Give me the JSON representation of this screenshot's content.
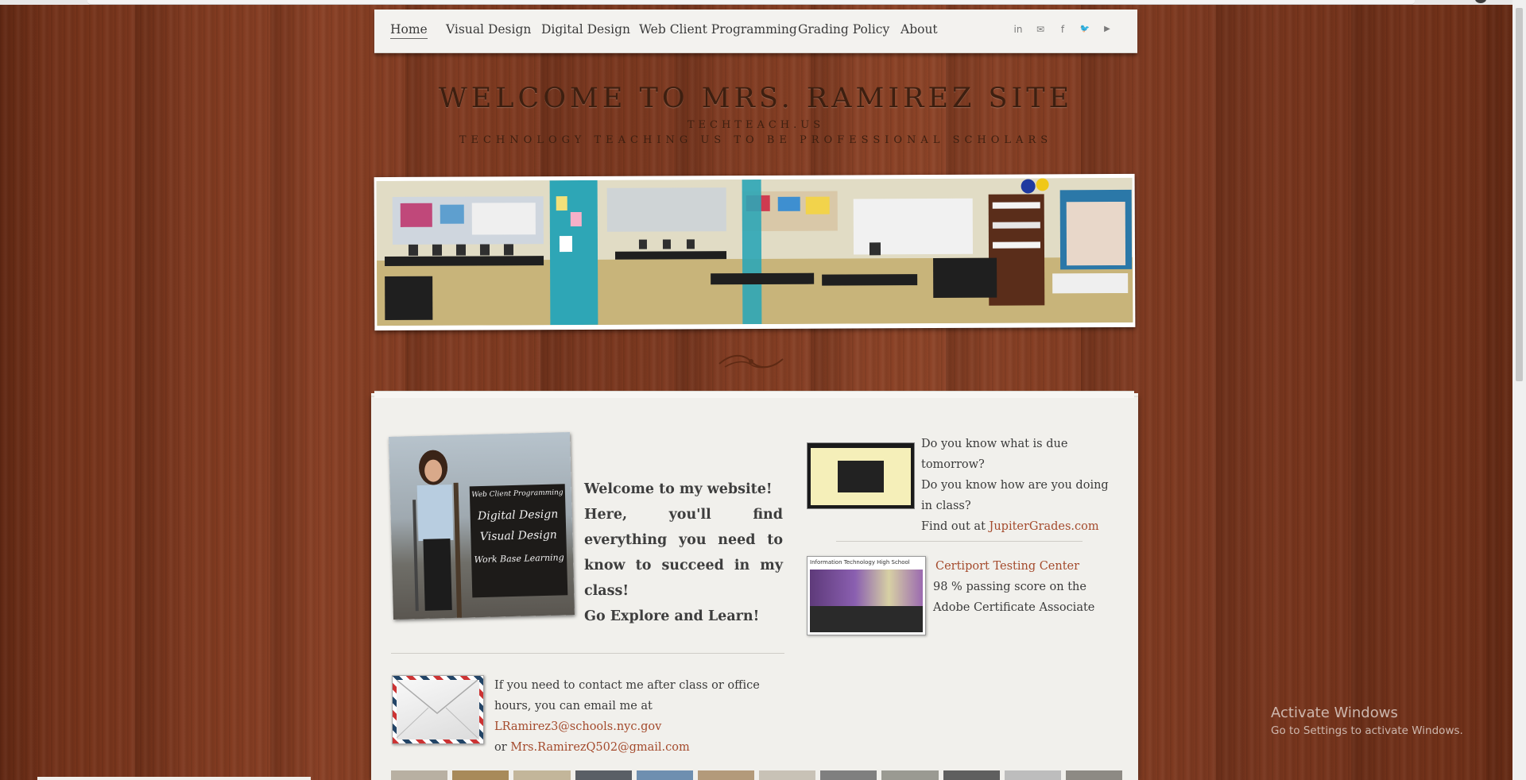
{
  "nav": {
    "items": [
      "Home",
      "Visual Design",
      "Digital Design",
      "Web Client Programming",
      "Grading Policy",
      "About"
    ],
    "active": "Home",
    "social": [
      "linkedin-icon",
      "mail-icon",
      "facebook-icon",
      "twitter-icon",
      "youtube-icon"
    ],
    "social_glyphs": [
      "in",
      "✉",
      "f",
      "🐦",
      "▶"
    ]
  },
  "header": {
    "title": "WELCOME TO MRS. RAMIREZ SITE",
    "subtitle": "TECHTEACH.US",
    "tagline": "TECHNOLOGY TEACHING US TO BE PROFESSIONAL SCHOLARS"
  },
  "profile_sign": [
    "Web Client Programming",
    "Digital Design",
    "Visual Design",
    "Work Base Learning"
  ],
  "welcome": {
    "line1": "Welcome to my website!",
    "line2": "Here, you'll find everything you need to know to succeed in my class!",
    "line3": "Go Explore and Learn!"
  },
  "contact": {
    "text": "If you need to contact me after class or office hours, you can email me at",
    "email1": "LRamirez3@schools.nyc.gov",
    "or": "or",
    "email2": "Mrs.RamirezQ502@gmail.com"
  },
  "jupiter": {
    "line1": "Do you know what is due tomorrow?",
    "line2": "Do you know how are you doing in class?",
    "find_prefix": "Find out at",
    "link": "JupiterGrades.com"
  },
  "certiport": {
    "link": "Certiport Testing Center",
    "line1": "98 % passing score  on the",
    "line2": "Adobe Certificate Associate",
    "thumb_header": "Information Technology High School"
  },
  "windows": {
    "title": "Activate Windows",
    "subtitle": "Go to Settings to activate Windows."
  },
  "colors": {
    "link": "#a44a2c",
    "title": "#3d1f10"
  }
}
